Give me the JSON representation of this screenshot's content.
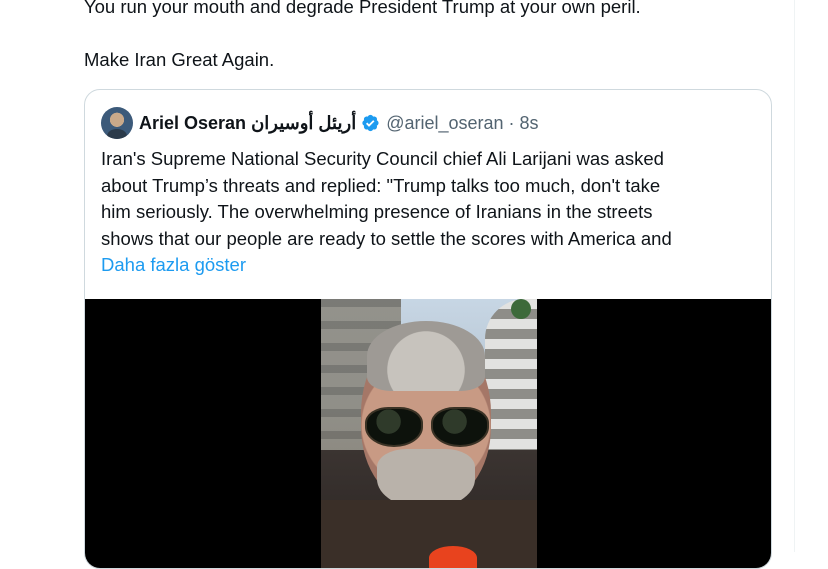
{
  "tweet": {
    "text_line1": "You run your mouth and degrade President Trump at your own peril.",
    "text_line2": "Make Iran Great Again."
  },
  "quoted_tweet": {
    "display_name": "Ariel Oseran أريئل أوسيران",
    "handle": "@ariel_oseran",
    "separator": "·",
    "time": "8s",
    "body_lines": [
      "Iran's Supreme National Security Council chief Ali Larijani was asked",
      "about Trump’s threats and replied: \"Trump talks too much, don't take",
      "him seriously. The overwhelming presence of Iranians in the streets",
      "shows that our people are ready to settle the scores with America and"
    ],
    "show_more": "Daha fazla göster",
    "media_type": "video"
  },
  "colors": {
    "text": "#0f1419",
    "secondary": "#536471",
    "link": "#1d9bf0",
    "border": "#cfd9de"
  },
  "icons": {
    "verified": "verified-badge-icon"
  }
}
